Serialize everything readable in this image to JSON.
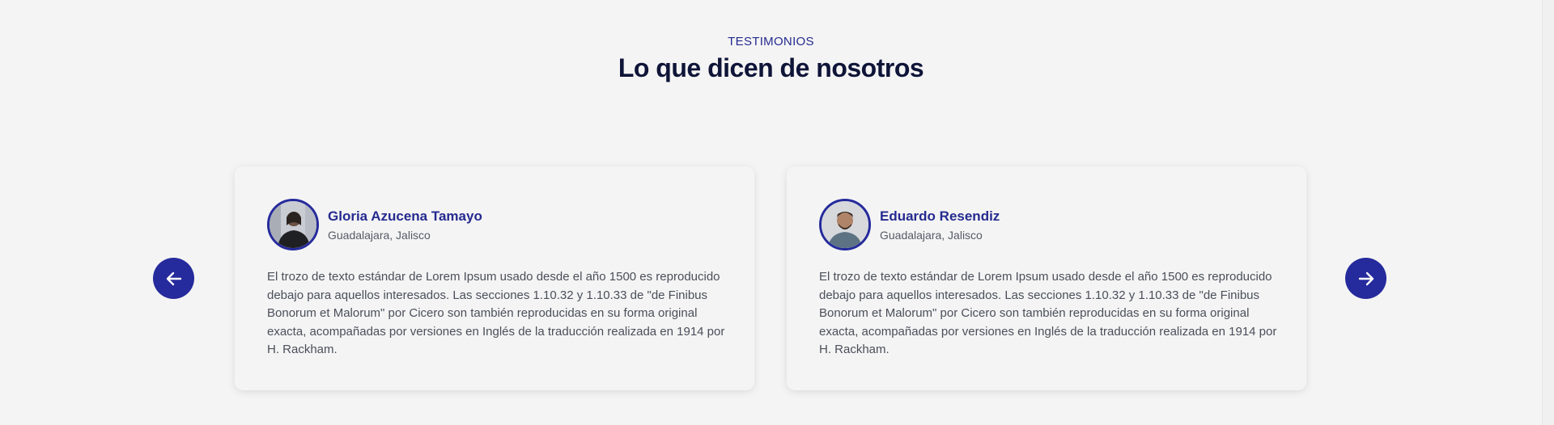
{
  "section": {
    "eyebrow": "TESTIMONIOS",
    "title": "Lo que dicen de nosotros"
  },
  "nav": {
    "prev_icon": "arrow-left-icon",
    "next_icon": "arrow-right-icon"
  },
  "colors": {
    "accent": "#252a9c",
    "heading": "#0f1538",
    "background": "#f4f4f4"
  },
  "testimonials": [
    {
      "name": "Gloria Azucena Tamayo",
      "location": "Guadalajara, Jalisco",
      "text": "El trozo de texto estándar de Lorem Ipsum usado desde el año 1500 es reproducido debajo para aquellos interesados. Las secciones 1.10.32 y 1.10.33 de \"de Finibus Bonorum et Malorum\" por Cicero son también reproducidas en su forma original exacta, acompañadas por versiones en Inglés de la traducción realizada en 1914 por H. Rackham."
    },
    {
      "name": "Eduardo Resendiz",
      "location": "Guadalajara, Jalisco",
      "text": "El trozo de texto estándar de Lorem Ipsum usado desde el año 1500 es reproducido debajo para aquellos interesados. Las secciones 1.10.32 y 1.10.33 de \"de Finibus Bonorum et Malorum\" por Cicero son también reproducidas en su forma original exacta, acompañadas por versiones en Inglés de la traducción realizada en 1914 por H. Rackham."
    }
  ]
}
